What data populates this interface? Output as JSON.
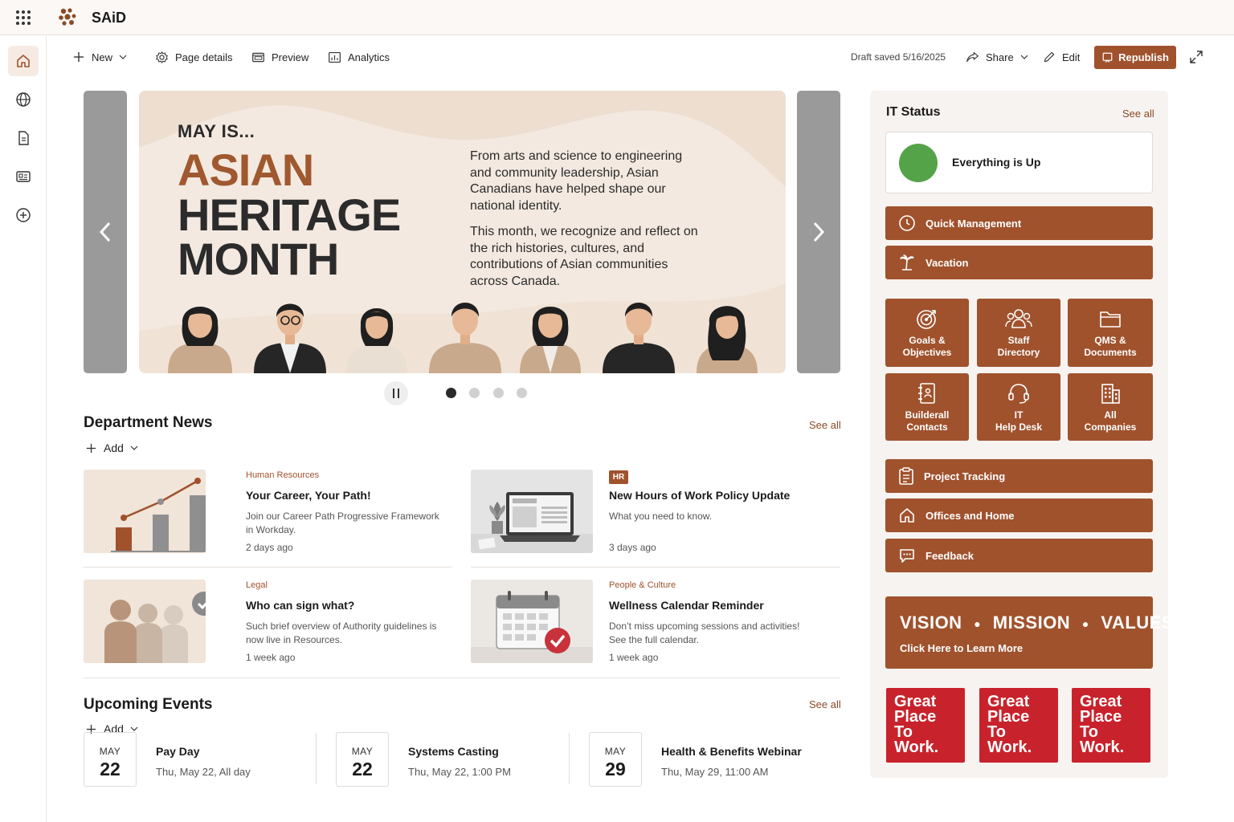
{
  "app": {
    "brand": "SAiD"
  },
  "commandbar": {
    "new_label": "New",
    "page_details_label": "Page details",
    "preview_label": "Preview",
    "analytics_label": "Analytics",
    "draft_status": "Draft saved 5/16/2025",
    "share_label": "Share",
    "edit_label": "Edit",
    "republish_label": "Republish"
  },
  "rail": {
    "items": [
      "home-icon",
      "globe-icon",
      "document-icon",
      "news-icon",
      "add-icon"
    ]
  },
  "hero": {
    "kicker": "MAY IS...",
    "title_line1": "ASIAN",
    "title_line2": "HERITAGE",
    "title_line3": "MONTH",
    "paragraph1": "From arts and science to engineering and community leadership, Asian Canadians have helped shape our national identity.",
    "paragraph2": "This month, we recognize and reflect on the rich histories, cultures, and contributions of Asian communities across Canada.",
    "accent_color": "#a0582f",
    "slide_count": 4,
    "active_slide": 1
  },
  "news": {
    "title": "Department News",
    "see_all": "See all",
    "add_label": "Add",
    "items": [
      {
        "category": "Human Resources",
        "title": "Your Career, Your Path!",
        "description": "Join our Career Path Progressive Framework in Workday.",
        "time": "2 days ago"
      },
      {
        "badge": "HR",
        "title": "New Hours of Work Policy Update",
        "description": "What you need to know.",
        "time": "3 days ago"
      },
      {
        "category": "Legal",
        "title": "Who can sign what?",
        "description": "Such brief overview of Authority guidelines is now live in Resources.",
        "time": "1 week ago"
      },
      {
        "category": "People & Culture",
        "title": "Wellness Calendar Reminder",
        "description": "Don’t miss upcoming sessions and activities! See the full calendar.",
        "time": "1 week ago"
      }
    ]
  },
  "events": {
    "title": "Upcoming Events",
    "see_all": "See all",
    "add_label": "Add",
    "items": [
      {
        "month": "MAY",
        "day": "22",
        "title": "Pay Day",
        "when": "Thu, May 22, All day"
      },
      {
        "month": "MAY",
        "day": "22",
        "title": "Systems Casting",
        "when": "Thu, May 22, 1:00 PM"
      },
      {
        "month": "MAY",
        "day": "29",
        "title": "Health & Benefits Webinar",
        "when": "Thu, May 29, 11:00 AM"
      }
    ]
  },
  "it_status": {
    "title": "IT Status",
    "see_all": "See all",
    "status_text": "Everything is Up",
    "status_color": "#55a348"
  },
  "quicklinks": {
    "accent_color": "#a0522d",
    "quick_management": "Quick Management",
    "vacation": "Vacation",
    "tiles": [
      {
        "line1": "Goals &",
        "line2": "Objectives",
        "icon": "target-icon"
      },
      {
        "line1": "Staff",
        "line2": "Directory",
        "icon": "people-icon"
      },
      {
        "line1": "QMS &",
        "line2": "Documents",
        "icon": "folder-icon"
      },
      {
        "line1": "Builderall",
        "line2": "Contacts",
        "icon": "contact-book-icon"
      },
      {
        "line1": "IT",
        "line2": "Help Desk",
        "icon": "headset-icon"
      },
      {
        "line1": "All",
        "line2": "Companies",
        "icon": "building-icon"
      }
    ],
    "project_tracking": "Project Tracking",
    "offices_home": "Offices and Home",
    "feedback": "Feedback"
  },
  "vmv": {
    "word1": "VISION",
    "word2": "MISSION",
    "word3": "VALUES",
    "sub": "Click Here to Learn More"
  },
  "gptw": {
    "line1": "Great",
    "line2": "Place",
    "line3": "To",
    "line4": "Work.",
    "color": "#c8232c"
  }
}
